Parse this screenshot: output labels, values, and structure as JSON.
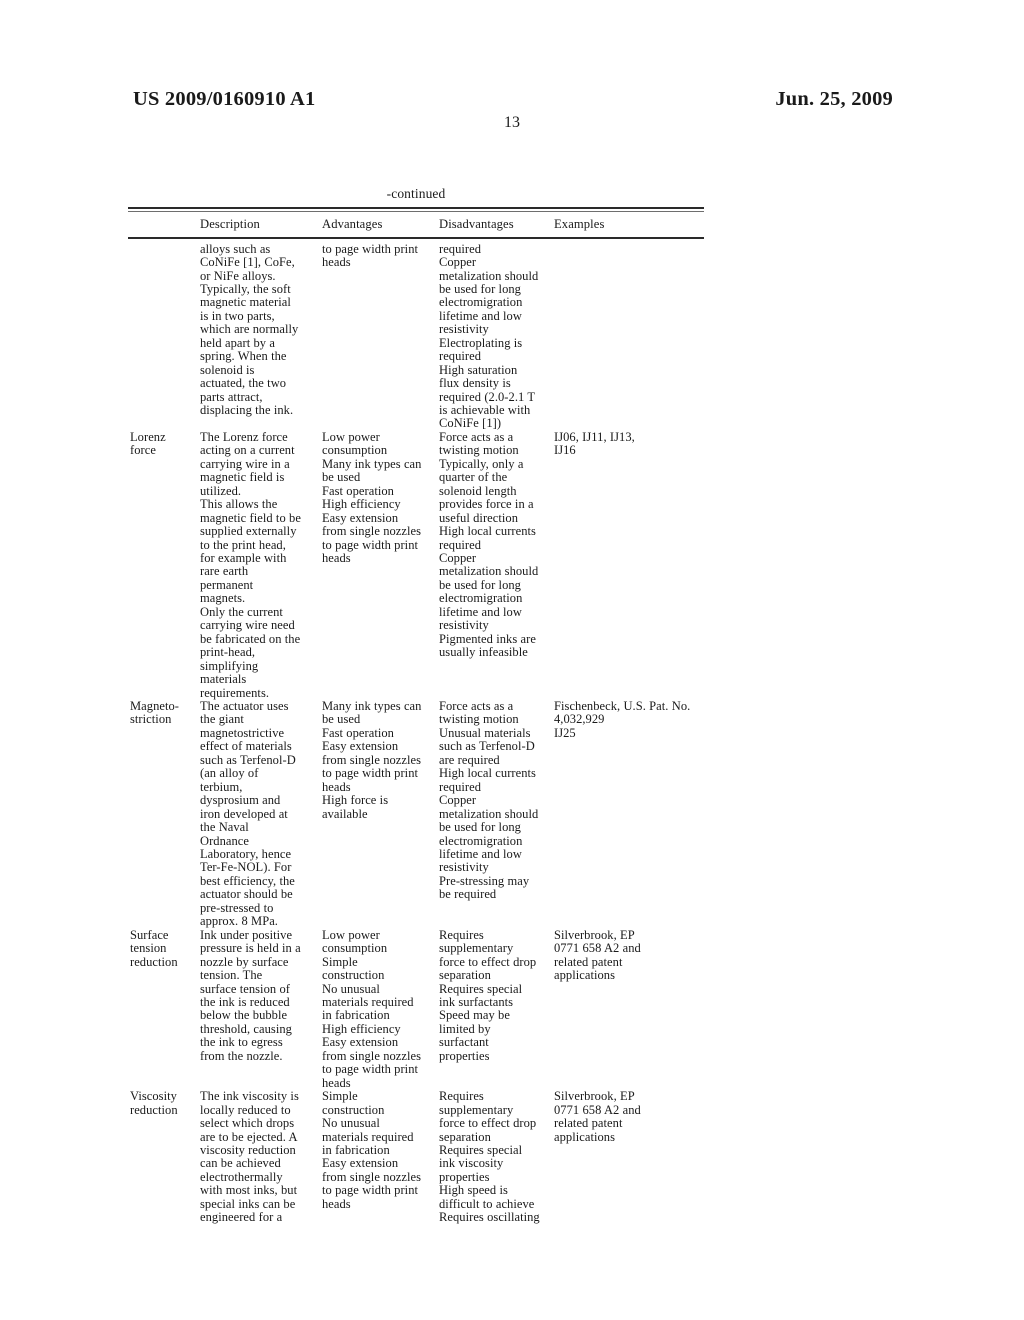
{
  "header": {
    "publication_number": "US 2009/0160910 A1",
    "publication_date": "Jun. 25, 2009",
    "page_number": "13"
  },
  "table": {
    "continued_label": "-continued",
    "columns": [
      {
        "key": "name",
        "label": ""
      },
      {
        "key": "description",
        "label": "Description"
      },
      {
        "key": "advantages",
        "label": "Advantages"
      },
      {
        "key": "disadvantages",
        "label": "Disadvantages"
      },
      {
        "key": "examples",
        "label": "Examples"
      }
    ],
    "rows": [
      {
        "name": "",
        "description": "alloys such as\nCoNiFe [1], CoFe,\nor NiFe alloys.\nTypically, the soft\nmagnetic material\nis in two parts,\nwhich are normally\nheld apart by a\nspring. When the\nsolenoid is\nactuated, the two\nparts attract,\ndisplacing the ink.",
        "advantages": "to page width print\nheads",
        "disadvantages": "required\nCopper\nmetalization should\nbe used for long\nelectromigration\nlifetime and low\nresistivity\nElectroplating is\nrequired\nHigh saturation\nflux density is\nrequired (2.0-2.1 T\nis achievable with\nCoNiFe [1])",
        "examples": ""
      },
      {
        "name": "Lorenz\nforce",
        "description": "The Lorenz force\nacting on a current\ncarrying wire in a\nmagnetic field is\nutilized.\nThis allows the\nmagnetic field to be\nsupplied externally\nto the print head,\nfor example with\nrare earth\npermanent\nmagnets.\nOnly the current\ncarrying wire need\nbe fabricated on the\nprint-head,\nsimplifying\nmaterials\nrequirements.",
        "advantages": "Low power\nconsumption\nMany ink types can\nbe used\nFast operation\nHigh efficiency\nEasy extension\nfrom single nozzles\nto page width print\nheads",
        "disadvantages": "Force acts as a\ntwisting motion\nTypically, only a\nquarter of the\nsolenoid length\nprovides force in a\nuseful direction\nHigh local currents\nrequired\nCopper\nmetalization should\nbe used for long\nelectromigration\nlifetime and low\nresistivity\nPigmented inks are\nusually infeasible",
        "examples": "IJ06, IJ11, IJ13,\nIJ16"
      },
      {
        "name": "Magneto-\nstriction",
        "description": "The actuator uses\nthe giant\nmagnetostrictive\neffect of materials\nsuch as Terfenol-D\n(an alloy of\nterbium,\ndysprosium and\niron developed at\nthe Naval\nOrdnance\nLaboratory, hence\nTer-Fe-NOL). For\nbest efficiency, the\nactuator should be\npre-stressed to\napprox. 8 MPa.",
        "advantages": "Many ink types can\nbe used\nFast operation\nEasy extension\nfrom single nozzles\nto page width print\nheads\nHigh force is\navailable",
        "disadvantages": "Force acts as a\ntwisting motion\nUnusual materials\nsuch as Terfenol-D\nare required\nHigh local currents\nrequired\nCopper\nmetalization should\nbe used for long\nelectromigration\nlifetime and low\nresistivity\nPre-stressing may\nbe required",
        "examples": "Fischenbeck, U.S. Pat. No.\n4,032,929\nIJ25"
      },
      {
        "name": "Surface\ntension\nreduction",
        "description": "Ink under positive\npressure is held in a\nnozzle by surface\ntension. The\nsurface tension of\nthe ink is reduced\nbelow the bubble\nthreshold, causing\nthe ink to egress\nfrom the nozzle.",
        "advantages": "Low power\nconsumption\nSimple\nconstruction\nNo unusual\nmaterials required\nin fabrication\nHigh efficiency\nEasy extension\nfrom single nozzles\nto page width print\nheads",
        "disadvantages": "Requires\nsupplementary\nforce to effect drop\nseparation\nRequires special\nink surfactants\nSpeed may be\nlimited by\nsurfactant\nproperties",
        "examples": "Silverbrook, EP\n0771 658 A2 and\nrelated patent\napplications"
      },
      {
        "name": "Viscosity\nreduction",
        "description": "The ink viscosity is\nlocally reduced to\nselect which drops\nare to be ejected. A\nviscosity reduction\ncan be achieved\nelectrothermally\nwith most inks, but\nspecial inks can be\nengineered for a",
        "advantages": "Simple\nconstruction\nNo unusual\nmaterials required\nin fabrication\nEasy extension\nfrom single nozzles\nto page width print\nheads",
        "disadvantages": "Requires\nsupplementary\nforce to effect drop\nseparation\nRequires special\nink viscosity\nproperties\nHigh speed is\ndifficult to achieve\nRequires oscillating",
        "examples": "Silverbrook, EP\n0771 658 A2 and\nrelated patent\napplications"
      }
    ]
  }
}
